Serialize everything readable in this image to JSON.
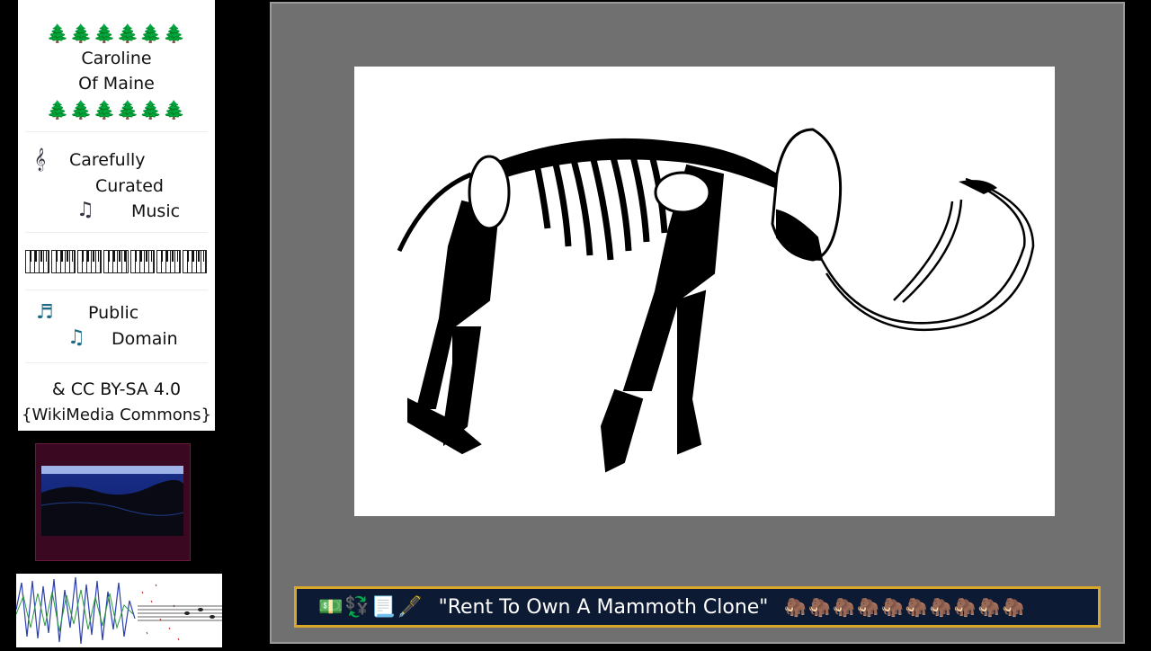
{
  "panel": {
    "trees": "🌲🌲🌲🌲🌲🌲",
    "name_line1": "Caroline",
    "name_line2": "Of Maine",
    "tagline_word1": "Carefully",
    "tagline_word2": "Curated",
    "tagline_word3": "Music",
    "license_word1": "Public",
    "license_word2": "Domain",
    "license_line3": "&  CC BY-SA 4.0",
    "license_line4": "{WikiMedia Commons}"
  },
  "icons": {
    "clef": "treble-clef-icon",
    "notes": "music-notes-icon",
    "note": "music-note-icon",
    "piano": "piano-keys-icon"
  },
  "caption": {
    "emoji": "💵💱📃🖋️",
    "text": "\"Rent To Own A Mammoth Clone\"",
    "mammoths": "🦣🦣🦣🦣🦣🦣🦣🦣🦣🦣"
  },
  "colors": {
    "caption_bg": "#0d1a33",
    "caption_border": "#d8a62a",
    "stage_bg": "#707070",
    "thumb_bg": "#3a0820"
  }
}
